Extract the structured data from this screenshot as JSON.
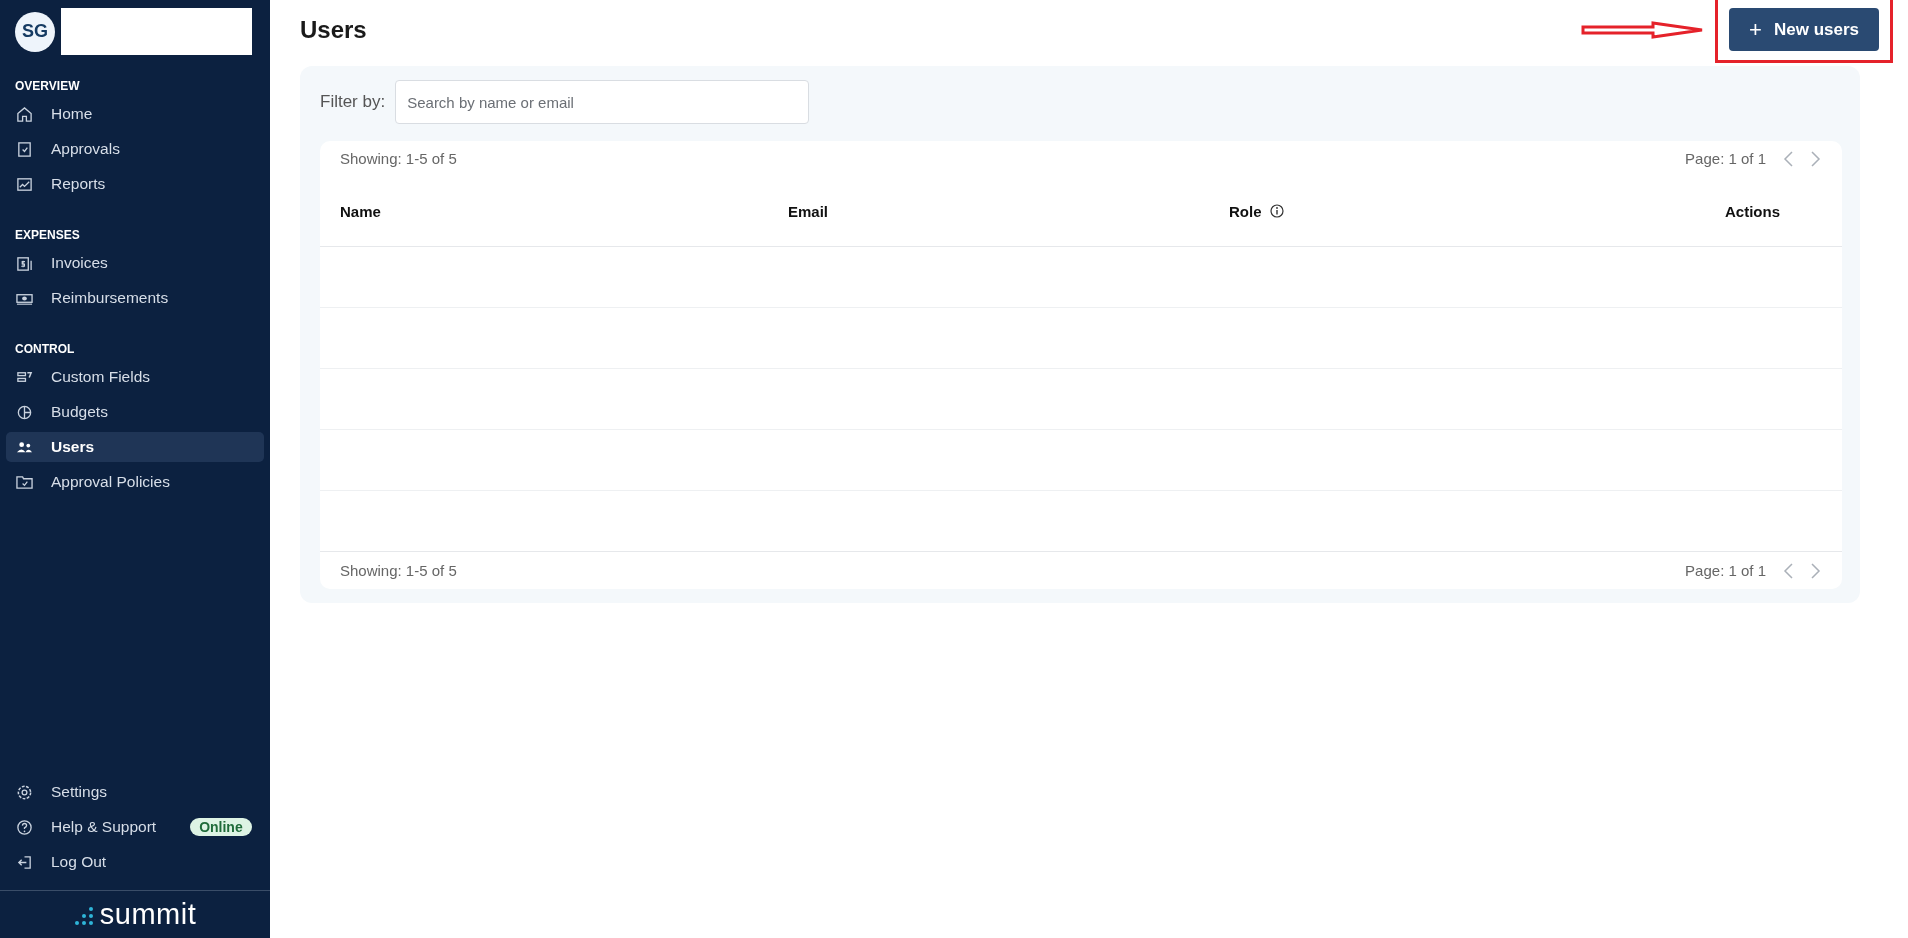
{
  "sidebar": {
    "avatar_initials": "SG",
    "sections": [
      {
        "heading": "OVERVIEW",
        "items": [
          {
            "label": "Home",
            "selected": false
          },
          {
            "label": "Approvals",
            "selected": false
          },
          {
            "label": "Reports",
            "selected": false
          }
        ]
      },
      {
        "heading": "EXPENSES",
        "items": [
          {
            "label": "Invoices",
            "selected": false
          },
          {
            "label": "Reimbursements",
            "selected": false
          }
        ]
      },
      {
        "heading": "CONTROL",
        "items": [
          {
            "label": "Custom Fields",
            "selected": false
          },
          {
            "label": "Budgets",
            "selected": false
          },
          {
            "label": "Users",
            "selected": true
          },
          {
            "label": "Approval Policies",
            "selected": false
          }
        ]
      }
    ],
    "footer_items": [
      {
        "label": "Settings"
      },
      {
        "label": "Help & Support",
        "badge": "Online"
      },
      {
        "label": "Log Out"
      }
    ],
    "logo": "summit"
  },
  "page": {
    "title": "Users",
    "new_button": "New users",
    "new_button_icon": "+"
  },
  "filter": {
    "label": "Filter by:",
    "placeholder": "Search by name or email"
  },
  "table": {
    "top_showing": "Showing: 1-5 of 5",
    "top_page": "Page: 1 of 1",
    "columns": [
      {
        "label": "Name",
        "kind": "plain"
      },
      {
        "label": "Email",
        "kind": "plain"
      },
      {
        "label": "Role",
        "kind": "info"
      },
      {
        "label": "Actions",
        "kind": "plain"
      }
    ],
    "bottom_showing": "Showing: 1-5 of 5",
    "bottom_page": "Page: 1 of 1"
  }
}
